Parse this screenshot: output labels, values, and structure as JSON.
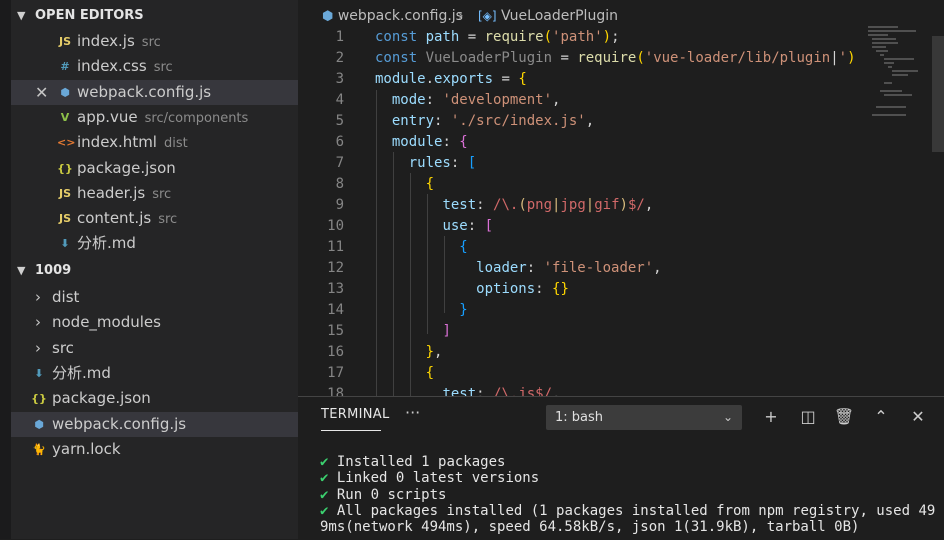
{
  "sidebar": {
    "open_editors": {
      "title": "OPEN EDITORS",
      "items": [
        {
          "label": "index.js",
          "desc": "src",
          "icon": "JS",
          "icon_color": "#e6cd69"
        },
        {
          "label": "index.css",
          "desc": "src",
          "icon": "#",
          "icon_color": "#519aba"
        },
        {
          "label": "webpack.config.js",
          "desc": "",
          "icon": "⬢",
          "icon_color": "#6aa8d8"
        },
        {
          "label": "app.vue",
          "desc": "src/components",
          "icon": "V",
          "icon_color": "#8dc149"
        },
        {
          "label": "index.html",
          "desc": "dist",
          "icon": "<>",
          "icon_color": "#e37933"
        },
        {
          "label": "package.json",
          "desc": "",
          "icon": "{}",
          "icon_color": "#cbcb41"
        },
        {
          "label": "header.js",
          "desc": "src",
          "icon": "JS",
          "icon_color": "#e6cd69"
        },
        {
          "label": "content.js",
          "desc": "src",
          "icon": "JS",
          "icon_color": "#e6cd69"
        },
        {
          "label": "分析.md",
          "desc": "",
          "icon": "⬇",
          "icon_color": "#519aba"
        }
      ],
      "close_glyph": "✕"
    },
    "project": {
      "title": "1009",
      "items": [
        {
          "label": "dist",
          "type": "folder"
        },
        {
          "label": "node_modules",
          "type": "folder"
        },
        {
          "label": "src",
          "type": "folder"
        },
        {
          "label": "分析.md",
          "type": "file",
          "icon": "⬇",
          "icon_color": "#519aba"
        },
        {
          "label": "package.json",
          "type": "file",
          "icon": "{}",
          "icon_color": "#cbcb41"
        },
        {
          "label": "webpack.config.js",
          "type": "file",
          "icon": "⬢",
          "icon_color": "#6aa8d8"
        },
        {
          "label": "yarn.lock",
          "type": "file",
          "icon": "🐈",
          "icon_color": "#2c8ebb"
        }
      ]
    }
  },
  "editor": {
    "breadcrumb": {
      "file": "webpack.config.js",
      "symbol": "VueLoaderPlugin"
    },
    "lines": [
      {
        "n": "1",
        "tokens": [
          [
            "kw",
            "const "
          ],
          [
            "var",
            "path"
          ],
          [
            "p",
            " = "
          ],
          [
            "fn",
            "require"
          ],
          [
            "b1",
            "("
          ],
          [
            "str",
            "'path'"
          ],
          [
            "b1",
            ")"
          ],
          [
            "p",
            ";"
          ]
        ]
      },
      {
        "n": "2",
        "tokens": [
          [
            "kw",
            "const "
          ],
          [
            "dim",
            "VueLoaderPlugin"
          ],
          [
            "p",
            " = "
          ],
          [
            "fn",
            "require"
          ],
          [
            "b1",
            "("
          ],
          [
            "str",
            "'vue-loader/lib/plugin"
          ],
          [
            "p",
            "|"
          ],
          [
            "str",
            "'"
          ],
          [
            "b1",
            ")"
          ]
        ]
      },
      {
        "n": "3",
        "tokens": [
          [
            "var",
            "module"
          ],
          [
            "p",
            "."
          ],
          [
            "var",
            "exports"
          ],
          [
            "p",
            " = "
          ],
          [
            "b1",
            "{"
          ]
        ]
      },
      {
        "n": "4",
        "tokens": [
          [
            "p",
            "  "
          ],
          [
            "var",
            "mode"
          ],
          [
            "p",
            ": "
          ],
          [
            "str",
            "'development'"
          ],
          [
            "p",
            ","
          ]
        ]
      },
      {
        "n": "5",
        "tokens": [
          [
            "p",
            "  "
          ],
          [
            "var",
            "entry"
          ],
          [
            "p",
            ": "
          ],
          [
            "str",
            "'./src/index.js'"
          ],
          [
            "p",
            ","
          ]
        ]
      },
      {
        "n": "6",
        "tokens": [
          [
            "p",
            "  "
          ],
          [
            "var",
            "module"
          ],
          [
            "p",
            ": "
          ],
          [
            "b2",
            "{"
          ]
        ]
      },
      {
        "n": "7",
        "tokens": [
          [
            "p",
            "    "
          ],
          [
            "var",
            "rules"
          ],
          [
            "p",
            ": "
          ],
          [
            "b3",
            "["
          ]
        ]
      },
      {
        "n": "8",
        "tokens": [
          [
            "p",
            "      "
          ],
          [
            "b1",
            "{"
          ]
        ]
      },
      {
        "n": "9",
        "tokens": [
          [
            "p",
            "        "
          ],
          [
            "var",
            "test"
          ],
          [
            "p",
            ": "
          ],
          [
            "reg",
            "/\\."
          ],
          [
            "rg2",
            "("
          ],
          [
            "reg",
            "png"
          ],
          [
            "rg2",
            "|"
          ],
          [
            "reg",
            "jpg"
          ],
          [
            "rg2",
            "|"
          ],
          [
            "reg",
            "gif"
          ],
          [
            "rg2",
            ")"
          ],
          [
            "reg",
            "$/"
          ],
          [
            "p",
            ","
          ]
        ]
      },
      {
        "n": "10",
        "tokens": [
          [
            "p",
            "        "
          ],
          [
            "var",
            "use"
          ],
          [
            "p",
            ": "
          ],
          [
            "b2",
            "["
          ]
        ]
      },
      {
        "n": "11",
        "tokens": [
          [
            "p",
            "          "
          ],
          [
            "b3",
            "{"
          ]
        ]
      },
      {
        "n": "12",
        "tokens": [
          [
            "p",
            "            "
          ],
          [
            "var",
            "loader"
          ],
          [
            "p",
            ": "
          ],
          [
            "str",
            "'file-loader'"
          ],
          [
            "p",
            ","
          ]
        ]
      },
      {
        "n": "13",
        "tokens": [
          [
            "p",
            "            "
          ],
          [
            "var",
            "options"
          ],
          [
            "p",
            ": "
          ],
          [
            "b1",
            "{}"
          ]
        ]
      },
      {
        "n": "14",
        "tokens": [
          [
            "p",
            "          "
          ],
          [
            "b3",
            "}"
          ]
        ]
      },
      {
        "n": "15",
        "tokens": [
          [
            "p",
            "        "
          ],
          [
            "b2",
            "]"
          ]
        ]
      },
      {
        "n": "16",
        "tokens": [
          [
            "p",
            "      "
          ],
          [
            "b1",
            "}"
          ],
          [
            "p",
            ","
          ]
        ]
      },
      {
        "n": "17",
        "tokens": [
          [
            "p",
            "      "
          ],
          [
            "b1",
            "{"
          ]
        ]
      },
      {
        "n": "18",
        "tokens": [
          [
            "p",
            "        "
          ],
          [
            "var",
            "test"
          ],
          [
            "p",
            ": "
          ],
          [
            "reg",
            "/\\.js$/"
          ],
          [
            "p",
            ","
          ]
        ]
      }
    ]
  },
  "panel": {
    "tab": "TERMINAL",
    "more": "···",
    "shell": "1: bash",
    "tools": [
      {
        "name": "new-terminal-icon",
        "glyph": "+"
      },
      {
        "name": "split-terminal-icon",
        "glyph": "◫"
      },
      {
        "name": "kill-terminal-icon",
        "glyph": "🗑"
      },
      {
        "name": "maximize-panel-icon",
        "glyph": "⌃"
      },
      {
        "name": "close-panel-icon",
        "glyph": "✕"
      }
    ],
    "output": [
      {
        "check": "✔",
        "text": " Installed 1 packages"
      },
      {
        "check": "✔",
        "text": " Linked 0 latest versions"
      },
      {
        "check": "✔",
        "text": " Run 0 scripts"
      },
      {
        "check": "✔",
        "text": " All packages installed (1 packages installed from npm registry, used 49"
      },
      {
        "check": "",
        "text": "9ms(network 494ms), speed 64.58kB/s, json 1(31.9kB), tarball 0B)"
      }
    ]
  }
}
